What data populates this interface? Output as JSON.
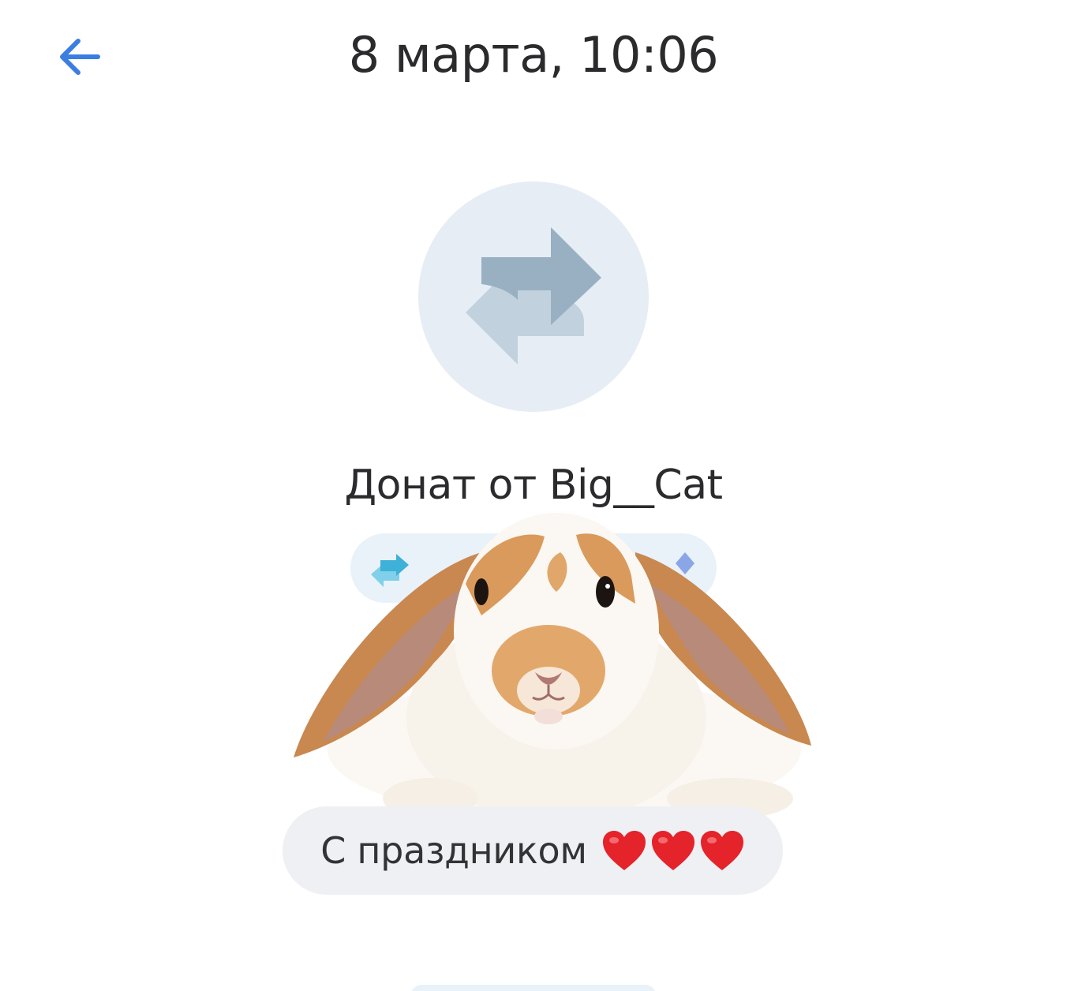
{
  "header": {
    "title": "8 марта, 10:06",
    "back_icon": "arrow-left-icon",
    "accent_color": "#3b7ee0"
  },
  "transfer": {
    "avatar_icon": "exchange-arrows-icon",
    "title": "Донат от Big__Cat"
  },
  "sticker": {
    "subject": "bunny-sticker"
  },
  "message": {
    "text": "С праздником",
    "emoji": "heart-icon",
    "emoji_count": 3
  },
  "colors": {
    "avatar_bg": "#e6edf5",
    "pill_bg": "#e9f1f9",
    "bubble_bg": "#eff0f3",
    "heart": "#e5232b"
  }
}
